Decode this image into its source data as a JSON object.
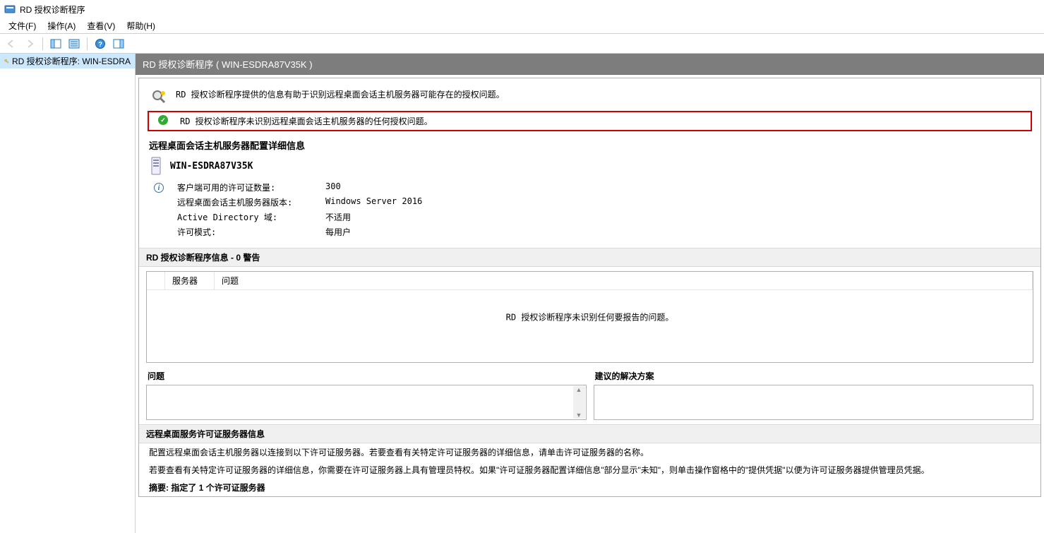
{
  "window": {
    "title": "RD 授权诊断程序"
  },
  "menubar": [
    {
      "label": "文件(F)"
    },
    {
      "label": "操作(A)"
    },
    {
      "label": "查看(V)"
    },
    {
      "label": "帮助(H)"
    }
  ],
  "tree": {
    "root_label": "RD 授权诊断程序: WIN-ESDRA"
  },
  "header": {
    "title": "RD 授权诊断程序 ( WIN-ESDRA87V35K )"
  },
  "intro": {
    "text": "RD 授权诊断程序提供的信息有助于识别远程桌面会话主机服务器可能存在的授权问题。",
    "status_ok": "RD 授权诊断程序未识别远程桌面会话主机服务器的任何授权问题。"
  },
  "config": {
    "heading": "远程桌面会话主机服务器配置详细信息",
    "server_name": "WIN-ESDRA87V35K",
    "rows": [
      {
        "k": "客户端可用的许可证数量:",
        "v": "300"
      },
      {
        "k": "远程桌面会话主机服务器版本:",
        "v": "Windows Server 2016"
      },
      {
        "k": "Active Directory 域:",
        "v": "不适用"
      },
      {
        "k": "许可模式:",
        "v": "每用户"
      }
    ]
  },
  "diag": {
    "heading": "RD 授权诊断程序信息 - 0 警告",
    "columns": [
      "服务器",
      "问题"
    ],
    "empty_text": "RD 授权诊断程序未识别任何要报告的问题。"
  },
  "boxes": {
    "issue_label": "问题",
    "solution_label": "建议的解决方案"
  },
  "license": {
    "heading": "远程桌面服务许可证服务器信息",
    "line1": "配置远程桌面会话主机服务器以连接到以下许可证服务器。若要查看有关特定许可证服务器的详细信息，请单击许可证服务器的名称。",
    "line2": "若要查看有关特定许可证服务器的详细信息，你需要在许可证服务器上具有管理员特权。如果\"许可证服务器配置详细信息\"部分显示\"未知\"，则单击操作窗格中的\"提供凭据\"以便为许可证服务器提供管理员凭据。",
    "summary": "摘要: 指定了 1 个许可证服务器"
  }
}
